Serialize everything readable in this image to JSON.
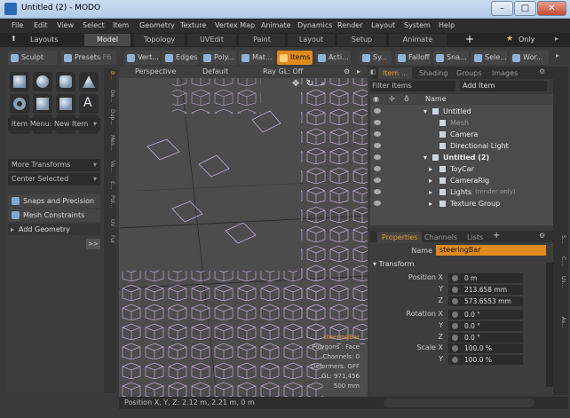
{
  "window": {
    "title": "Untitled (2) - MODO"
  },
  "menu": [
    "File",
    "Edit",
    "View",
    "Select",
    "Item",
    "Geometry",
    "Texture",
    "Vertex Map",
    "Animate",
    "Dynamics",
    "Render",
    "Layout",
    "System",
    "Help"
  ],
  "layout_tabs": {
    "layouts_label": "Layouts",
    "tabs": [
      "Model",
      "Topology",
      "UVEdit",
      "Paint",
      "Layout",
      "Setup",
      "Animate"
    ],
    "active": "Model",
    "plus": "+",
    "only_label": "Only"
  },
  "toolbar": {
    "sculpt": "Sculpt",
    "presets": "Presets",
    "presets_key": "F6",
    "modes": [
      "Vert...",
      "Edges",
      "Poly...",
      "Mat...",
      "Items",
      "Acti..."
    ],
    "active_mode": "Items",
    "extra": [
      "Sy...",
      "Falloff",
      "Sna...",
      "Sele...",
      "Wor..."
    ]
  },
  "left_panel": {
    "item_menu": "Item Menu: New Item",
    "more_transforms": "More Transforms",
    "center_selected": "Center Selected",
    "snaps": "Snaps and Precision",
    "mesh_constraints": "Mesh Constraints",
    "add_geometry": "Add Geometry",
    "expand": ">>",
    "side_tabs": [
      "B...",
      "De...",
      "Dup...",
      "Mes...",
      "Ve...",
      "E...",
      "Pol...",
      "UV",
      "Fur"
    ]
  },
  "viewport": {
    "view": "Perspective",
    "shading": "Default",
    "raygl": "Ray GL: Off",
    "info": {
      "selected": "steeringBar",
      "polygons": "Polygons : Face",
      "channels": "Channels: 0",
      "deformers": "Deformers: OFF",
      "gl": "GL: 971,456",
      "scale": "500 mm"
    }
  },
  "items_panel": {
    "tabs": [
      "Item ...",
      "Shading",
      "Groups",
      "Images"
    ],
    "active": "Item ...",
    "filter": "Filter Items",
    "add_item": "Add Item",
    "name_col": "Name",
    "rows": [
      {
        "label": "Untitled",
        "bold": false,
        "indent": 1
      },
      {
        "label": "Mesh",
        "bold": false,
        "indent": 2,
        "dim": true
      },
      {
        "label": "Camera",
        "bold": false,
        "indent": 2
      },
      {
        "label": "Directional Light",
        "bold": false,
        "indent": 2
      },
      {
        "label": "Untitled (2)",
        "bold": true,
        "indent": 1
      },
      {
        "label": "ToyCar",
        "bold": false,
        "indent": 2
      },
      {
        "label": "CameraRig",
        "bold": false,
        "indent": 2
      },
      {
        "label": "Lights",
        "bold": false,
        "indent": 2,
        "suffix": "(render only)"
      },
      {
        "label": "Texture Group",
        "bold": false,
        "indent": 2
      }
    ]
  },
  "properties": {
    "tabs": [
      "Properties",
      "Channels",
      "Lists"
    ],
    "active": "Properties",
    "plus": "+",
    "name_label": "Name",
    "name_value": "steeringBar",
    "section": "Transform",
    "rows": [
      {
        "label": "Position X",
        "value": "0 m"
      },
      {
        "label": "Y",
        "value": "213.658 mm"
      },
      {
        "label": "Z",
        "value": "573.6553 mm"
      },
      {
        "label": "Rotation X",
        "value": "0.0 °"
      },
      {
        "label": "Y",
        "value": "0.0 °"
      },
      {
        "label": "Z",
        "value": "0.0 °"
      },
      {
        "label": "Scale X",
        "value": "100.0 %"
      },
      {
        "label": "Y",
        "value": "100.0 %"
      }
    ]
  },
  "right_strip": [
    "S...",
    "C...",
    "Us...",
    "As..."
  ],
  "status": "Position X, Y, Z:   2.12 m, 2.21 m, 0 m"
}
